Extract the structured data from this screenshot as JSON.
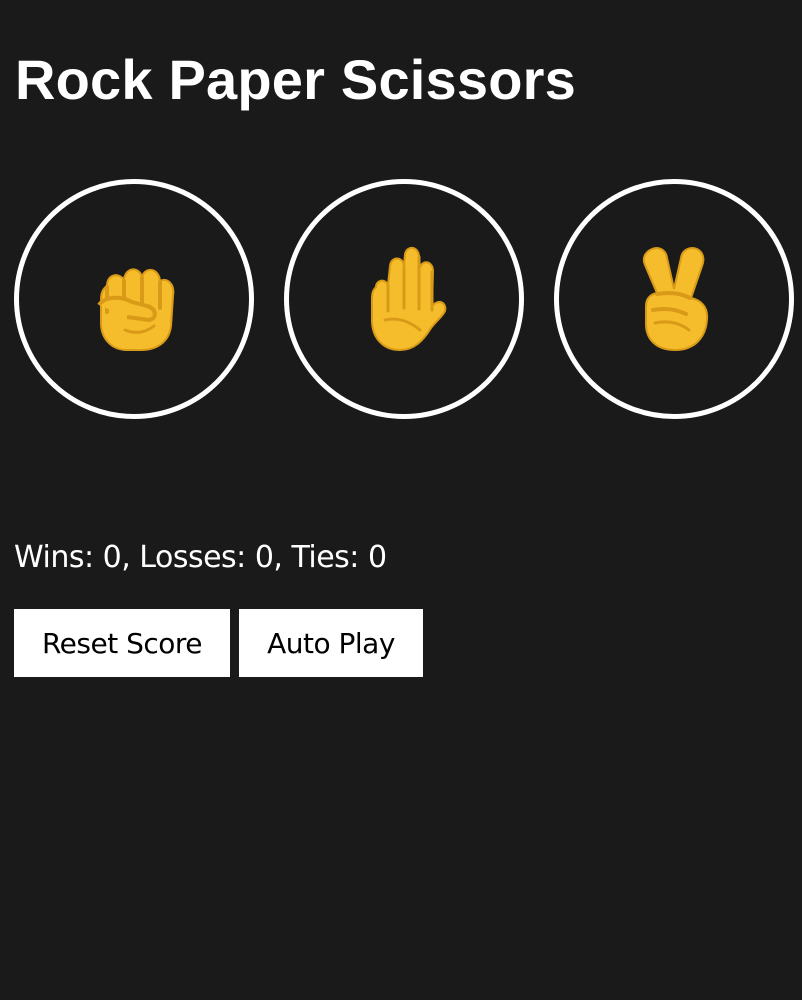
{
  "game": {
    "title": "Rock Paper Scissors",
    "moves": [
      {
        "name": "rock",
        "icon": "raised-fist-icon",
        "color": "#F5BC2B"
      },
      {
        "name": "paper",
        "icon": "raised-hand-icon",
        "color": "#F5BC2B"
      },
      {
        "name": "scissors",
        "icon": "victory-hand-icon",
        "color": "#F5BC2B"
      }
    ],
    "score_text": "Wins: 0, Losses: 0, Ties: 0",
    "score": {
      "wins": 0,
      "losses": 0,
      "ties": 0
    },
    "reset_label": "Reset Score",
    "auto_play_label": "Auto Play"
  },
  "colors": {
    "background": "#1A1A1A",
    "text": "#FFFFFF",
    "button_background": "#FFFFFF",
    "button_text": "#000000",
    "emoji_yellow": "#F5BC2B",
    "emoji_outline": "#D99A18"
  }
}
